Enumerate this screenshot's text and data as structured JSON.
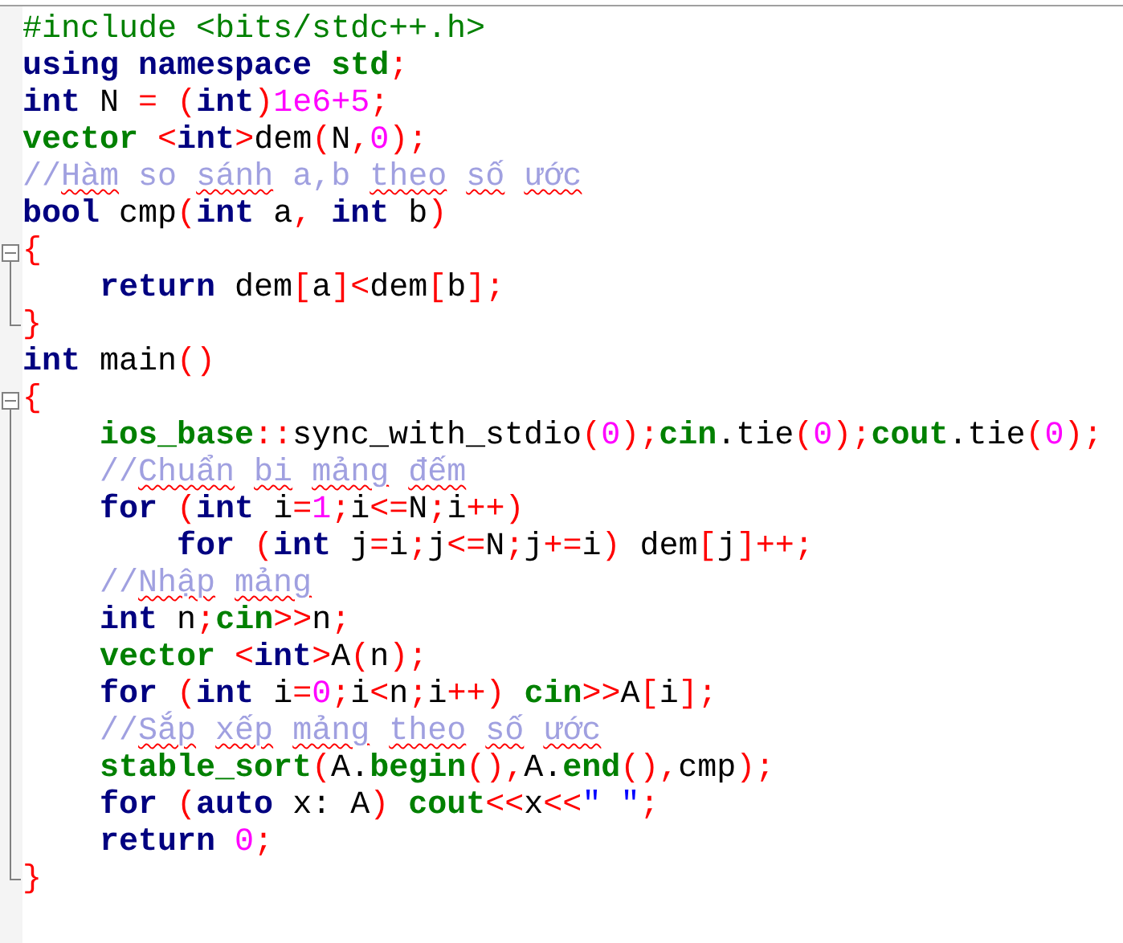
{
  "lines": [
    {
      "tokens": [
        {
          "kind": "pp",
          "text": "#include <bits/stdc++.h>"
        }
      ]
    },
    {
      "tokens": [
        {
          "kind": "kw",
          "text": "using"
        },
        {
          "kind": "kw",
          "text": " namespace"
        },
        {
          "kind": "id",
          "text": " std"
        },
        {
          "kind": "sym",
          "text": ";"
        }
      ]
    },
    {
      "tokens": [
        {
          "kind": "kw",
          "text": "int"
        },
        {
          "kind": "plain",
          "text": " N "
        },
        {
          "kind": "sym",
          "text": "="
        },
        {
          "kind": "sym",
          "text": " ("
        },
        {
          "kind": "kw",
          "text": "int"
        },
        {
          "kind": "sym",
          "text": ")"
        },
        {
          "kind": "num",
          "text": "1e6+5"
        },
        {
          "kind": "sym",
          "text": ";"
        }
      ]
    },
    {
      "tokens": [
        {
          "kind": "id",
          "text": "vector"
        },
        {
          "kind": "sym",
          "text": " <"
        },
        {
          "kind": "kw",
          "text": "int"
        },
        {
          "kind": "sym",
          "text": ">"
        },
        {
          "kind": "plain",
          "text": "dem"
        },
        {
          "kind": "sym",
          "text": "("
        },
        {
          "kind": "plain",
          "text": "N"
        },
        {
          "kind": "sym",
          "text": ","
        },
        {
          "kind": "num",
          "text": "0"
        },
        {
          "kind": "sym",
          "text": ");"
        }
      ]
    },
    {
      "tokens": [
        {
          "kind": "cm",
          "text": "//"
        },
        {
          "kind": "typo",
          "text": "Hàm"
        },
        {
          "kind": "cm",
          "text": " so "
        },
        {
          "kind": "typo",
          "text": "sánh"
        },
        {
          "kind": "cm",
          "text": " a,b "
        },
        {
          "kind": "typo",
          "text": "theo"
        },
        {
          "kind": "typo",
          "text": " số"
        },
        {
          "kind": "typo",
          "text": " ước"
        }
      ]
    },
    {
      "tokens": [
        {
          "kind": "kw",
          "text": "bool"
        },
        {
          "kind": "plain",
          "text": " cmp"
        },
        {
          "kind": "sym",
          "text": "("
        },
        {
          "kind": "kw",
          "text": "int"
        },
        {
          "kind": "plain",
          "text": " a"
        },
        {
          "kind": "sym",
          "text": ","
        },
        {
          "kind": "kw",
          "text": " int"
        },
        {
          "kind": "plain",
          "text": " b"
        },
        {
          "kind": "sym",
          "text": ")"
        }
      ]
    },
    {
      "expanded": true,
      "tokens": [
        {
          "kind": "sym",
          "text": "{"
        }
      ],
      "children": [
        {
          "tokens": [
            {
              "kind": "kw",
              "text": "return"
            },
            {
              "kind": "plain",
              "text": " dem"
            },
            {
              "kind": "sym",
              "text": "["
            },
            {
              "kind": "plain",
              "text": "a"
            },
            {
              "kind": "sym",
              "text": "]<"
            },
            {
              "kind": "plain",
              "text": "dem"
            },
            {
              "kind": "sym",
              "text": "["
            },
            {
              "kind": "plain",
              "text": "b"
            },
            {
              "kind": "sym",
              "text": "];"
            }
          ]
        }
      ]
    },
    {
      "tokens": [
        {
          "kind": "sym",
          "text": "}"
        }
      ]
    },
    {
      "tokens": [
        {
          "kind": "kw",
          "text": "int"
        },
        {
          "kind": "plain",
          "text": " main"
        },
        {
          "kind": "sym",
          "text": "()"
        }
      ]
    },
    {
      "expanded": true,
      "tokens": [
        {
          "kind": "sym",
          "text": "{"
        }
      ],
      "children": [
        {
          "tokens": [
            {
              "kind": "id",
              "text": "ios_base"
            },
            {
              "kind": "sym",
              "text": "::"
            },
            {
              "kind": "plain",
              "text": "sync_with_stdio"
            },
            {
              "kind": "sym",
              "text": "("
            },
            {
              "kind": "num",
              "text": "0"
            },
            {
              "kind": "sym",
              "text": ");"
            },
            {
              "kind": "id",
              "text": "cin"
            },
            {
              "kind": "plain",
              "text": ".tie"
            },
            {
              "kind": "sym",
              "text": "("
            },
            {
              "kind": "num",
              "text": "0"
            },
            {
              "kind": "sym",
              "text": ");"
            },
            {
              "kind": "id",
              "text": "cout"
            },
            {
              "kind": "plain",
              "text": ".tie"
            },
            {
              "kind": "sym",
              "text": "("
            },
            {
              "kind": "num",
              "text": "0"
            },
            {
              "kind": "sym",
              "text": ");"
            }
          ]
        },
        {
          "tokens": [
            {
              "kind": "cm",
              "text": "//"
            },
            {
              "kind": "typo",
              "text": "Chuẩn"
            },
            {
              "kind": "typo",
              "text": " bi"
            },
            {
              "kind": "typo",
              "text": " mảng"
            },
            {
              "kind": "typo",
              "text": " đếm"
            }
          ]
        },
        {
          "tokens": [
            {
              "kind": "kw",
              "text": "for"
            },
            {
              "kind": "sym",
              "text": " ("
            },
            {
              "kind": "kw",
              "text": "int"
            },
            {
              "kind": "plain",
              "text": " i"
            },
            {
              "kind": "sym",
              "text": "="
            },
            {
              "kind": "num",
              "text": "1"
            },
            {
              "kind": "sym",
              "text": ";"
            },
            {
              "kind": "plain",
              "text": "i"
            },
            {
              "kind": "sym",
              "text": "<="
            },
            {
              "kind": "plain",
              "text": "N"
            },
            {
              "kind": "sym",
              "text": ";"
            },
            {
              "kind": "plain",
              "text": "i"
            },
            {
              "kind": "sym",
              "text": "++)"
            }
          ],
          "children": [
            {
              "tokens": [
                {
                  "kind": "kw",
                  "text": "for"
                },
                {
                  "kind": "sym",
                  "text": " ("
                },
                {
                  "kind": "kw",
                  "text": "int"
                },
                {
                  "kind": "plain",
                  "text": " j"
                },
                {
                  "kind": "sym",
                  "text": "="
                },
                {
                  "kind": "plain",
                  "text": "i"
                },
                {
                  "kind": "sym",
                  "text": ";"
                },
                {
                  "kind": "plain",
                  "text": "j"
                },
                {
                  "kind": "sym",
                  "text": "<="
                },
                {
                  "kind": "plain",
                  "text": "N"
                },
                {
                  "kind": "sym",
                  "text": ";"
                },
                {
                  "kind": "plain",
                  "text": "j"
                },
                {
                  "kind": "sym",
                  "text": "+="
                },
                {
                  "kind": "plain",
                  "text": "i"
                },
                {
                  "kind": "sym",
                  "text": ")"
                },
                {
                  "kind": "plain",
                  "text": " dem"
                },
                {
                  "kind": "sym",
                  "text": "["
                },
                {
                  "kind": "plain",
                  "text": "j"
                },
                {
                  "kind": "sym",
                  "text": "]++;"
                }
              ]
            }
          ]
        },
        {
          "tokens": [
            {
              "kind": "cm",
              "text": "//"
            },
            {
              "kind": "typo",
              "text": "Nhập"
            },
            {
              "kind": "typo",
              "text": " mảng"
            }
          ]
        },
        {
          "tokens": [
            {
              "kind": "kw",
              "text": "int"
            },
            {
              "kind": "plain",
              "text": " n"
            },
            {
              "kind": "sym",
              "text": ";"
            },
            {
              "kind": "id",
              "text": "cin"
            },
            {
              "kind": "sym",
              "text": ">>"
            },
            {
              "kind": "plain",
              "text": "n"
            },
            {
              "kind": "sym",
              "text": ";"
            }
          ]
        },
        {
          "tokens": [
            {
              "kind": "id",
              "text": "vector"
            },
            {
              "kind": "sym",
              "text": " <"
            },
            {
              "kind": "kw",
              "text": "int"
            },
            {
              "kind": "sym",
              "text": ">"
            },
            {
              "kind": "plain",
              "text": "A"
            },
            {
              "kind": "sym",
              "text": "("
            },
            {
              "kind": "plain",
              "text": "n"
            },
            {
              "kind": "sym",
              "text": ");"
            }
          ]
        },
        {
          "tokens": [
            {
              "kind": "kw",
              "text": "for"
            },
            {
              "kind": "sym",
              "text": " ("
            },
            {
              "kind": "kw",
              "text": "int"
            },
            {
              "kind": "plain",
              "text": " i"
            },
            {
              "kind": "sym",
              "text": "="
            },
            {
              "kind": "num",
              "text": "0"
            },
            {
              "kind": "sym",
              "text": ";"
            },
            {
              "kind": "plain",
              "text": "i"
            },
            {
              "kind": "sym",
              "text": "<"
            },
            {
              "kind": "plain",
              "text": "n"
            },
            {
              "kind": "sym",
              "text": ";"
            },
            {
              "kind": "plain",
              "text": "i"
            },
            {
              "kind": "sym",
              "text": "++)"
            },
            {
              "kind": "id",
              "text": " cin"
            },
            {
              "kind": "sym",
              "text": ">>"
            },
            {
              "kind": "plain",
              "text": "A"
            },
            {
              "kind": "sym",
              "text": "["
            },
            {
              "kind": "plain",
              "text": "i"
            },
            {
              "kind": "sym",
              "text": "];"
            }
          ]
        },
        {
          "tokens": [
            {
              "kind": "cm",
              "text": "//"
            },
            {
              "kind": "typo",
              "text": "Sắp"
            },
            {
              "kind": "typo",
              "text": " xếp"
            },
            {
              "kind": "typo",
              "text": " mảng"
            },
            {
              "kind": "typo",
              "text": " theo"
            },
            {
              "kind": "typo",
              "text": " số"
            },
            {
              "kind": "typo",
              "text": " ước"
            }
          ]
        },
        {
          "tokens": [
            {
              "kind": "id",
              "text": "stable_sort"
            },
            {
              "kind": "sym",
              "text": "("
            },
            {
              "kind": "plain",
              "text": "A."
            },
            {
              "kind": "id",
              "text": "begin"
            },
            {
              "kind": "sym",
              "text": "(),"
            },
            {
              "kind": "plain",
              "text": "A."
            },
            {
              "kind": "id",
              "text": "end"
            },
            {
              "kind": "sym",
              "text": "(),"
            },
            {
              "kind": "plain",
              "text": "cmp"
            },
            {
              "kind": "sym",
              "text": ");"
            }
          ]
        },
        {
          "tokens": [
            {
              "kind": "kw",
              "text": "for"
            },
            {
              "kind": "sym",
              "text": " ("
            },
            {
              "kind": "kw",
              "text": "auto"
            },
            {
              "kind": "plain",
              "text": " x: A"
            },
            {
              "kind": "sym",
              "text": ")"
            },
            {
              "kind": "id",
              "text": " cout"
            },
            {
              "kind": "sym",
              "text": "<<"
            },
            {
              "kind": "plain",
              "text": "x"
            },
            {
              "kind": "sym",
              "text": "<<"
            },
            {
              "kind": "str",
              "text": "\" \""
            },
            {
              "kind": "sym",
              "text": ";"
            }
          ]
        },
        {
          "tokens": [
            {
              "kind": "kw",
              "text": "return"
            },
            {
              "kind": "num",
              "text": " 0"
            },
            {
              "kind": "sym",
              "text": ";"
            }
          ]
        }
      ]
    },
    {
      "tokens": [
        {
          "kind": "sym",
          "text": "}"
        }
      ]
    }
  ]
}
